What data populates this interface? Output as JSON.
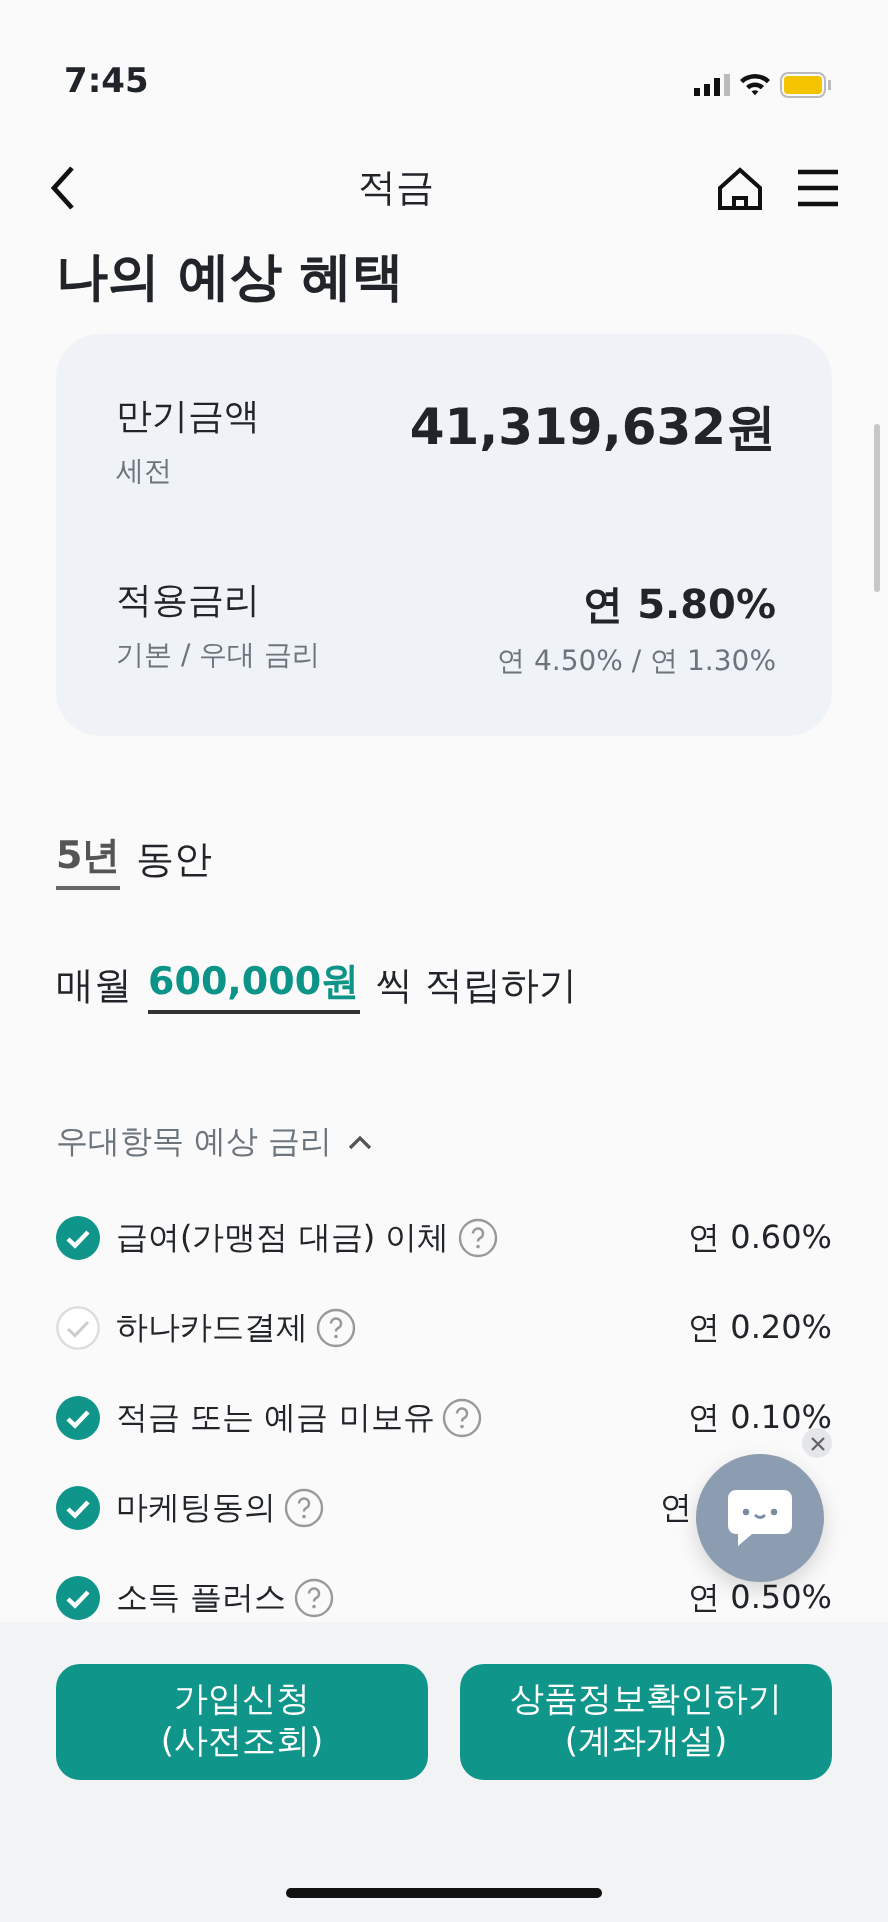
{
  "status_bar": {
    "time": "7:45"
  },
  "header": {
    "title": "적금"
  },
  "section_title": "나의 예상 혜택",
  "summary": [
    {
      "label": "만기금액",
      "sub": "세전",
      "value": "41,319,632원"
    },
    {
      "label": "적용금리",
      "sub": "기본 / 우대 금리",
      "value": "연 5.80%",
      "value_sub": "연 4.50% / 연 1.30%"
    }
  ],
  "period": {
    "value": "5년",
    "suffix": "동안"
  },
  "monthly": {
    "prefix": "매월",
    "amount": "600,000원",
    "suffix": "씩 적립하기"
  },
  "preferences": {
    "title": "우대항목 예상 금리",
    "expanded": true,
    "items": [
      {
        "label": "급여(가맹점 대금) 이체",
        "rate": "연 0.60%",
        "checked": true
      },
      {
        "label": "하나카드결제",
        "rate": "연 0.20%",
        "checked": false
      },
      {
        "label": "적금 또는 예금 미보유",
        "rate": "연 0.10%",
        "checked": true
      },
      {
        "label": "마케팅동의",
        "rate": "연",
        "checked": true
      },
      {
        "label": "소득 플러스",
        "rate": "연 0.50%",
        "checked": true
      }
    ]
  },
  "buttons": [
    {
      "line1": "가입신청",
      "line2": "(사전조회)"
    },
    {
      "line1": "상품정보확인하기",
      "line2": "(계좌개설)"
    }
  ]
}
